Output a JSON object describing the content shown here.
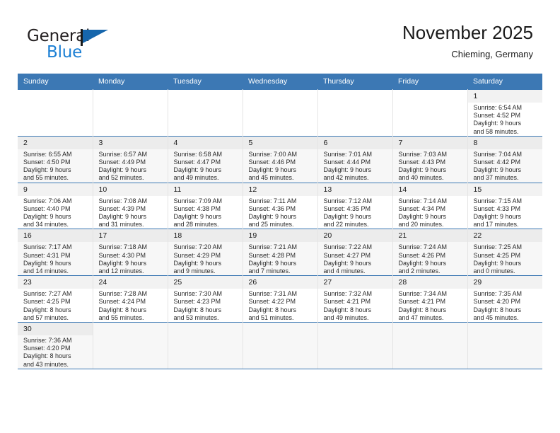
{
  "brand": {
    "name_part1": "General",
    "name_part2": "Blue",
    "accent_color": "#1b7fd4",
    "flag_color": "#1666ac"
  },
  "header": {
    "month_title": "November 2025",
    "location": "Chieming, Germany",
    "header_bg_color": "#3c78b4"
  },
  "weekdays": [
    "Sunday",
    "Monday",
    "Tuesday",
    "Wednesday",
    "Thursday",
    "Friday",
    "Saturday"
  ],
  "weeks": [
    [
      {
        "day": "",
        "sunrise": "",
        "sunset": "",
        "daylight_line1": "",
        "daylight_line2": ""
      },
      {
        "day": "",
        "sunrise": "",
        "sunset": "",
        "daylight_line1": "",
        "daylight_line2": ""
      },
      {
        "day": "",
        "sunrise": "",
        "sunset": "",
        "daylight_line1": "",
        "daylight_line2": ""
      },
      {
        "day": "",
        "sunrise": "",
        "sunset": "",
        "daylight_line1": "",
        "daylight_line2": ""
      },
      {
        "day": "",
        "sunrise": "",
        "sunset": "",
        "daylight_line1": "",
        "daylight_line2": ""
      },
      {
        "day": "",
        "sunrise": "",
        "sunset": "",
        "daylight_line1": "",
        "daylight_line2": ""
      },
      {
        "day": "1",
        "sunrise": "Sunrise: 6:54 AM",
        "sunset": "Sunset: 4:52 PM",
        "daylight_line1": "Daylight: 9 hours",
        "daylight_line2": "and 58 minutes."
      }
    ],
    [
      {
        "day": "2",
        "sunrise": "Sunrise: 6:55 AM",
        "sunset": "Sunset: 4:50 PM",
        "daylight_line1": "Daylight: 9 hours",
        "daylight_line2": "and 55 minutes."
      },
      {
        "day": "3",
        "sunrise": "Sunrise: 6:57 AM",
        "sunset": "Sunset: 4:49 PM",
        "daylight_line1": "Daylight: 9 hours",
        "daylight_line2": "and 52 minutes."
      },
      {
        "day": "4",
        "sunrise": "Sunrise: 6:58 AM",
        "sunset": "Sunset: 4:47 PM",
        "daylight_line1": "Daylight: 9 hours",
        "daylight_line2": "and 49 minutes."
      },
      {
        "day": "5",
        "sunrise": "Sunrise: 7:00 AM",
        "sunset": "Sunset: 4:46 PM",
        "daylight_line1": "Daylight: 9 hours",
        "daylight_line2": "and 45 minutes."
      },
      {
        "day": "6",
        "sunrise": "Sunrise: 7:01 AM",
        "sunset": "Sunset: 4:44 PM",
        "daylight_line1": "Daylight: 9 hours",
        "daylight_line2": "and 42 minutes."
      },
      {
        "day": "7",
        "sunrise": "Sunrise: 7:03 AM",
        "sunset": "Sunset: 4:43 PM",
        "daylight_line1": "Daylight: 9 hours",
        "daylight_line2": "and 40 minutes."
      },
      {
        "day": "8",
        "sunrise": "Sunrise: 7:04 AM",
        "sunset": "Sunset: 4:42 PM",
        "daylight_line1": "Daylight: 9 hours",
        "daylight_line2": "and 37 minutes."
      }
    ],
    [
      {
        "day": "9",
        "sunrise": "Sunrise: 7:06 AM",
        "sunset": "Sunset: 4:40 PM",
        "daylight_line1": "Daylight: 9 hours",
        "daylight_line2": "and 34 minutes."
      },
      {
        "day": "10",
        "sunrise": "Sunrise: 7:08 AM",
        "sunset": "Sunset: 4:39 PM",
        "daylight_line1": "Daylight: 9 hours",
        "daylight_line2": "and 31 minutes."
      },
      {
        "day": "11",
        "sunrise": "Sunrise: 7:09 AM",
        "sunset": "Sunset: 4:38 PM",
        "daylight_line1": "Daylight: 9 hours",
        "daylight_line2": "and 28 minutes."
      },
      {
        "day": "12",
        "sunrise": "Sunrise: 7:11 AM",
        "sunset": "Sunset: 4:36 PM",
        "daylight_line1": "Daylight: 9 hours",
        "daylight_line2": "and 25 minutes."
      },
      {
        "day": "13",
        "sunrise": "Sunrise: 7:12 AM",
        "sunset": "Sunset: 4:35 PM",
        "daylight_line1": "Daylight: 9 hours",
        "daylight_line2": "and 22 minutes."
      },
      {
        "day": "14",
        "sunrise": "Sunrise: 7:14 AM",
        "sunset": "Sunset: 4:34 PM",
        "daylight_line1": "Daylight: 9 hours",
        "daylight_line2": "and 20 minutes."
      },
      {
        "day": "15",
        "sunrise": "Sunrise: 7:15 AM",
        "sunset": "Sunset: 4:33 PM",
        "daylight_line1": "Daylight: 9 hours",
        "daylight_line2": "and 17 minutes."
      }
    ],
    [
      {
        "day": "16",
        "sunrise": "Sunrise: 7:17 AM",
        "sunset": "Sunset: 4:31 PM",
        "daylight_line1": "Daylight: 9 hours",
        "daylight_line2": "and 14 minutes."
      },
      {
        "day": "17",
        "sunrise": "Sunrise: 7:18 AM",
        "sunset": "Sunset: 4:30 PM",
        "daylight_line1": "Daylight: 9 hours",
        "daylight_line2": "and 12 minutes."
      },
      {
        "day": "18",
        "sunrise": "Sunrise: 7:20 AM",
        "sunset": "Sunset: 4:29 PM",
        "daylight_line1": "Daylight: 9 hours",
        "daylight_line2": "and 9 minutes."
      },
      {
        "day": "19",
        "sunrise": "Sunrise: 7:21 AM",
        "sunset": "Sunset: 4:28 PM",
        "daylight_line1": "Daylight: 9 hours",
        "daylight_line2": "and 7 minutes."
      },
      {
        "day": "20",
        "sunrise": "Sunrise: 7:22 AM",
        "sunset": "Sunset: 4:27 PM",
        "daylight_line1": "Daylight: 9 hours",
        "daylight_line2": "and 4 minutes."
      },
      {
        "day": "21",
        "sunrise": "Sunrise: 7:24 AM",
        "sunset": "Sunset: 4:26 PM",
        "daylight_line1": "Daylight: 9 hours",
        "daylight_line2": "and 2 minutes."
      },
      {
        "day": "22",
        "sunrise": "Sunrise: 7:25 AM",
        "sunset": "Sunset: 4:25 PM",
        "daylight_line1": "Daylight: 9 hours",
        "daylight_line2": "and 0 minutes."
      }
    ],
    [
      {
        "day": "23",
        "sunrise": "Sunrise: 7:27 AM",
        "sunset": "Sunset: 4:25 PM",
        "daylight_line1": "Daylight: 8 hours",
        "daylight_line2": "and 57 minutes."
      },
      {
        "day": "24",
        "sunrise": "Sunrise: 7:28 AM",
        "sunset": "Sunset: 4:24 PM",
        "daylight_line1": "Daylight: 8 hours",
        "daylight_line2": "and 55 minutes."
      },
      {
        "day": "25",
        "sunrise": "Sunrise: 7:30 AM",
        "sunset": "Sunset: 4:23 PM",
        "daylight_line1": "Daylight: 8 hours",
        "daylight_line2": "and 53 minutes."
      },
      {
        "day": "26",
        "sunrise": "Sunrise: 7:31 AM",
        "sunset": "Sunset: 4:22 PM",
        "daylight_line1": "Daylight: 8 hours",
        "daylight_line2": "and 51 minutes."
      },
      {
        "day": "27",
        "sunrise": "Sunrise: 7:32 AM",
        "sunset": "Sunset: 4:21 PM",
        "daylight_line1": "Daylight: 8 hours",
        "daylight_line2": "and 49 minutes."
      },
      {
        "day": "28",
        "sunrise": "Sunrise: 7:34 AM",
        "sunset": "Sunset: 4:21 PM",
        "daylight_line1": "Daylight: 8 hours",
        "daylight_line2": "and 47 minutes."
      },
      {
        "day": "29",
        "sunrise": "Sunrise: 7:35 AM",
        "sunset": "Sunset: 4:20 PM",
        "daylight_line1": "Daylight: 8 hours",
        "daylight_line2": "and 45 minutes."
      }
    ],
    [
      {
        "day": "30",
        "sunrise": "Sunrise: 7:36 AM",
        "sunset": "Sunset: 4:20 PM",
        "daylight_line1": "Daylight: 8 hours",
        "daylight_line2": "and 43 minutes."
      },
      {
        "day": "",
        "sunrise": "",
        "sunset": "",
        "daylight_line1": "",
        "daylight_line2": ""
      },
      {
        "day": "",
        "sunrise": "",
        "sunset": "",
        "daylight_line1": "",
        "daylight_line2": ""
      },
      {
        "day": "",
        "sunrise": "",
        "sunset": "",
        "daylight_line1": "",
        "daylight_line2": ""
      },
      {
        "day": "",
        "sunrise": "",
        "sunset": "",
        "daylight_line1": "",
        "daylight_line2": ""
      },
      {
        "day": "",
        "sunrise": "",
        "sunset": "",
        "daylight_line1": "",
        "daylight_line2": ""
      },
      {
        "day": "",
        "sunrise": "",
        "sunset": "",
        "daylight_line1": "",
        "daylight_line2": ""
      }
    ]
  ]
}
